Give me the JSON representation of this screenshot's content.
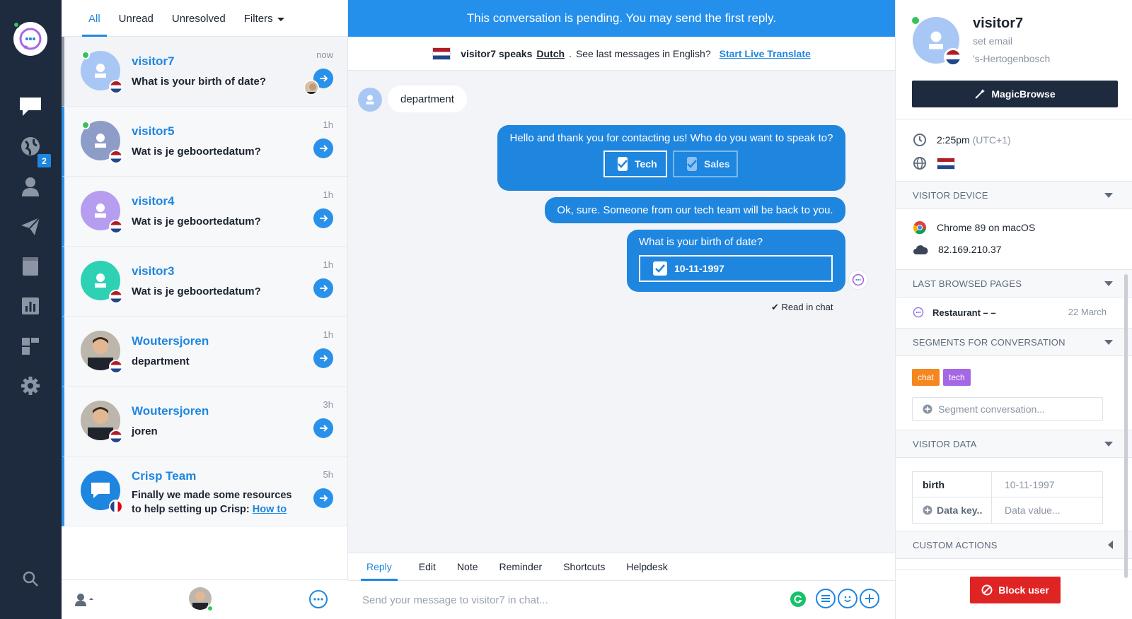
{
  "list": {
    "tabs": [
      "All",
      "Unread",
      "Unresolved",
      "Filters"
    ],
    "conversations": [
      {
        "name": "visitor7",
        "message": "What is your birth of date?",
        "time": "now"
      },
      {
        "name": "visitor5",
        "message": "Wat is je geboortedatum?",
        "time": "1h"
      },
      {
        "name": "visitor4",
        "message": "Wat is je geboortedatum?",
        "time": "1h"
      },
      {
        "name": "visitor3",
        "message": "Wat is je geboortedatum?",
        "time": "1h"
      },
      {
        "name": "Woutersjoren",
        "message": "department",
        "time": "1h"
      },
      {
        "name": "Woutersjoren",
        "message": "joren",
        "time": "3h"
      },
      {
        "name": "Crisp Team",
        "message": "Finally we made some resources to help setting up Crisp:",
        "link": "How to",
        "time": "5h"
      }
    ]
  },
  "rail": {
    "badge": "2"
  },
  "chat": {
    "banner": "This conversation is pending. You may send the first reply.",
    "translate": {
      "name": "visitor7 speaks",
      "language": "Dutch",
      "question": "See last messages in English?",
      "link": "Start Live Translate"
    },
    "incoming": "department",
    "bot_greeting": "Hello and thank you for contacting us! Who do you want to speak to?",
    "choices": [
      "Tech",
      "Sales"
    ],
    "confirm": "Ok, sure. Someone from our tech team will be back to you.",
    "question": "What is your birth of date?",
    "answer": "10-11-1997",
    "read_status": "✔ Read in chat",
    "composer_tabs": [
      "Reply",
      "Edit",
      "Note",
      "Reminder",
      "Shortcuts",
      "Helpdesk"
    ],
    "composer_placeholder": "Send your message to visitor7 in chat..."
  },
  "profile": {
    "name": "visitor7",
    "email": "set email",
    "city": "'s-Hertogenbosch",
    "magic_label": "MagicBrowse",
    "time": "2:25pm",
    "timezone": "(UTC+1)",
    "sections": {
      "device": "VISITOR DEVICE",
      "pages": "LAST BROWSED PAGES",
      "segments": "SEGMENTS FOR CONVERSATION",
      "data": "VISITOR DATA",
      "actions": "CUSTOM ACTIONS"
    },
    "browser": "Chrome 89 on macOS",
    "ip": "82.169.210.37",
    "page_title": "Restaurant – –",
    "page_date": "22 March",
    "tags": [
      {
        "label": "chat",
        "color": "#f5871f"
      },
      {
        "label": "tech",
        "color": "#a667e4"
      }
    ],
    "segment_placeholder": "Segment conversation...",
    "data_key": "birth",
    "data_value": "10-11-1997",
    "data_key_placeholder": "Data key..",
    "data_value_placeholder": "Data value...",
    "block_label": "Block user"
  }
}
